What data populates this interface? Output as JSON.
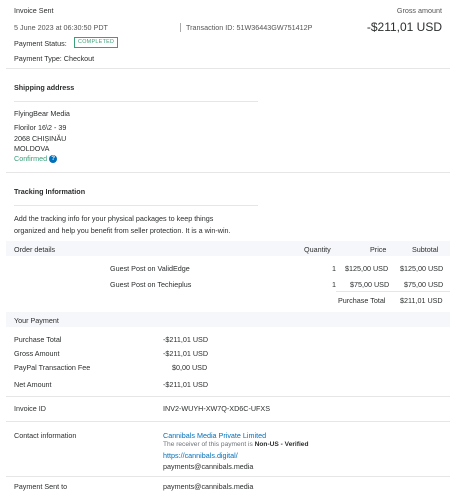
{
  "header": {
    "title": "Invoice Sent",
    "gross_label": "Gross amount",
    "datetime": "5 June 2023 at 06:30:50 PDT",
    "transaction_id": "Transaction ID: 51W36443GW751412P",
    "gross_amount": "-$211,01 USD",
    "payment_status_label": "Payment Status:",
    "payment_status": "COMPLETED",
    "payment_type": "Payment Type: Checkout"
  },
  "shipping": {
    "heading": "Shipping address",
    "name": "FlyingBear Media",
    "line1": "Florilor 16\\2 - 39",
    "line2": "2068 CHIȘINĂU",
    "country": "MOLDOVA",
    "confirmed": "Confirmed",
    "confirmed_icon": "info-icon"
  },
  "tracking": {
    "heading": "Tracking Information",
    "text_line1": "Add the tracking info for your physical packages to keep things",
    "text_line2": "organized and help you benefit from seller protection. It is a win-win."
  },
  "order": {
    "header_label": "Order details",
    "col_quantity": "Quantity",
    "col_price": "Price",
    "col_subtotal": "Subtotal",
    "items": [
      {
        "name": "Guest Post on ValidEdge",
        "qty": "1",
        "price": "$125,00 USD",
        "subtotal": "$125,00 USD"
      },
      {
        "name": "Guest Post on Techieplus",
        "qty": "1",
        "price": "$75,00 USD",
        "subtotal": "$75,00 USD"
      }
    ],
    "purchase_total_label": "Purchase Total",
    "purchase_total": "$211,01 USD"
  },
  "payment": {
    "heading": "Your Payment",
    "rows": [
      {
        "label": "Purchase Total",
        "value": "-$211,01 USD"
      },
      {
        "label": "Gross Amount",
        "value": "-$211,01 USD"
      },
      {
        "label": "PayPal Transaction Fee",
        "value": "$0,00 USD"
      },
      {
        "label": "Net Amount",
        "value": "-$211,01 USD"
      }
    ],
    "invoice_label": "Invoice ID",
    "invoice_id": "INV2-WUYH-XW7Q-XD6C-UFXS",
    "contact_label": "Contact information",
    "contact_name": "Cannibals Media Private Limited",
    "contact_note_prefix": "The receiver of this payment is ",
    "contact_note_status": "Non-US - Verified",
    "contact_url": "https://cannibals.digital/",
    "contact_email": "payments@cannibals.media",
    "sent_to_label": "Payment Sent to",
    "sent_to": "payments@cannibals.media"
  },
  "colors": {
    "link": "#0070ba",
    "status_green": "#3aa07a",
    "section_bg": "#f5f7fa"
  }
}
